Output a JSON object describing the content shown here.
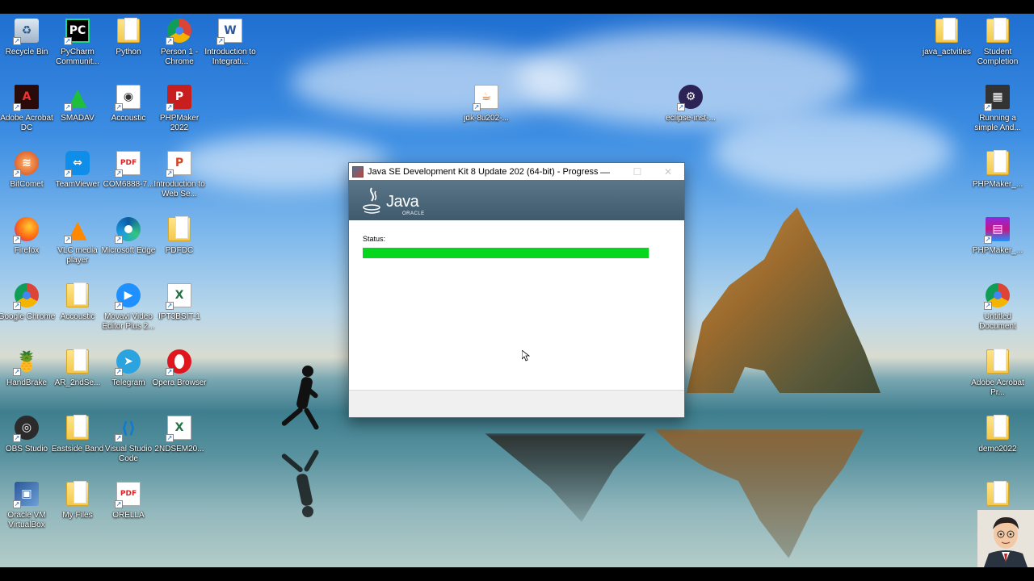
{
  "window": {
    "title": "Java SE Development Kit 8 Update 202 (64-bit) - Progress",
    "minimize": "—",
    "maximize": "☐",
    "close": "✕",
    "brand": "Java",
    "brand_sub": "ORACLE",
    "status_label": "Status:",
    "progress_fraction": 0.997
  },
  "desktop_icons": [
    {
      "label": "Recycle Bin",
      "icon": "recycle-bin-icon"
    },
    {
      "label": "PyCharm Communit...",
      "icon": "pycharm-icon"
    },
    {
      "label": "Python",
      "icon": "folder-icon"
    },
    {
      "label": "Person 1 - Chrome",
      "icon": "chrome-icon"
    },
    {
      "label": "Introduction to Integrati...",
      "icon": "word-document-icon"
    },
    {
      "label": "Adobe Acrobat DC",
      "icon": "acrobat-icon"
    },
    {
      "label": "SMADAV",
      "icon": "smadav-icon"
    },
    {
      "label": "Accoustic",
      "icon": "media-file-icon"
    },
    {
      "label": "PHPMaker 2022",
      "icon": "phpmaker-icon"
    },
    {
      "label": "BitComet",
      "icon": "bitcomet-icon"
    },
    {
      "label": "TeamViewer",
      "icon": "teamviewer-icon"
    },
    {
      "label": "COM6888-7...",
      "icon": "pdf-icon"
    },
    {
      "label": "Introduction to Web Se...",
      "icon": "powerpoint-icon"
    },
    {
      "label": "Firefox",
      "icon": "firefox-icon"
    },
    {
      "label": "VLC media player",
      "icon": "vlc-icon"
    },
    {
      "label": "Microsoft Edge",
      "icon": "edge-icon"
    },
    {
      "label": "PDFDC",
      "icon": "folder-icon"
    },
    {
      "label": "Google Chrome",
      "icon": "chrome-icon"
    },
    {
      "label": "Accoustic",
      "icon": "folder-icon"
    },
    {
      "label": "Movavi Video Editor Plus 2...",
      "icon": "movavi-icon"
    },
    {
      "label": "IPT3BSIT-1",
      "icon": "excel-icon"
    },
    {
      "label": "HandBrake",
      "icon": "handbrake-icon"
    },
    {
      "label": "AR_2ndSe...",
      "icon": "folder-icon"
    },
    {
      "label": "Telegram",
      "icon": "telegram-icon"
    },
    {
      "label": "Opera Browser",
      "icon": "opera-icon"
    },
    {
      "label": "OBS Studio",
      "icon": "obs-icon"
    },
    {
      "label": "Eastside Band",
      "icon": "folder-icon"
    },
    {
      "label": "Visual Studio Code",
      "icon": "vscode-icon"
    },
    {
      "label": "2NDSEM20...",
      "icon": "excel-icon"
    },
    {
      "label": "Oracle VM VirtualBox",
      "icon": "virtualbox-icon"
    },
    {
      "label": "My Files",
      "icon": "folder-icon"
    },
    {
      "label": "ORELLA",
      "icon": "pdf-icon"
    },
    {
      "label": "jdk-8u202-...",
      "icon": "java-installer-icon"
    },
    {
      "label": "eclipse-inst-...",
      "icon": "eclipse-installer-icon"
    },
    {
      "label": "java_actvities",
      "icon": "folder-icon"
    },
    {
      "label": "Student Completion",
      "icon": "folder-icon"
    },
    {
      "label": "Running a simple And...",
      "icon": "app-icon"
    },
    {
      "label": "PHPMaker_...",
      "icon": "folder-icon"
    },
    {
      "label": "PHPMaker_...",
      "icon": "winrar-icon"
    },
    {
      "label": "Untitled Document",
      "icon": "chrome-icon"
    },
    {
      "label": "Adobe Acrobat Pr...",
      "icon": "acrobat-folder-icon"
    },
    {
      "label": "demo2022",
      "icon": "folder-icon"
    },
    {
      "label": "",
      "icon": "folder-icon"
    }
  ]
}
